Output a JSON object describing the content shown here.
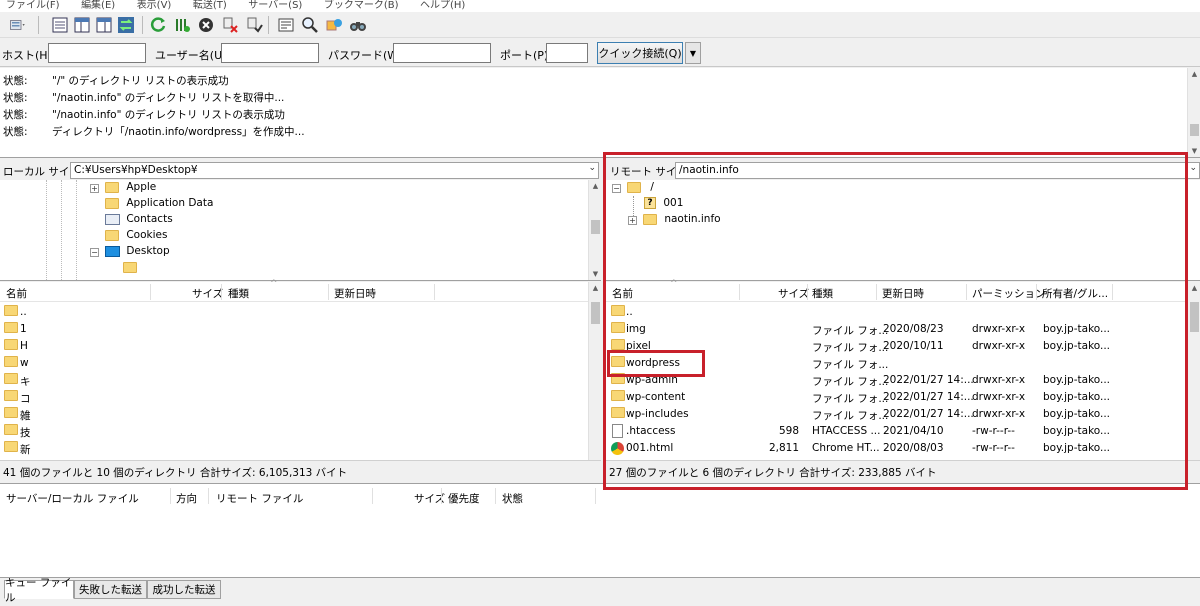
{
  "menu": [
    "ファイル(F)",
    "編集(E)",
    "表示(V)",
    "転送(T)",
    "サーバー(S)",
    "ブックマーク(B)",
    "ヘルプ(H)"
  ],
  "quickconnect": {
    "host_label": "ホスト(H):",
    "user_label": "ユーザー名(U):",
    "pass_label": "パスワード(W):",
    "port_label": "ポート(P):",
    "connect_label": "クイック接続(Q)",
    "dropdown": "▼"
  },
  "log": [
    {
      "status": "状態:",
      "message": "\"/\" のディレクトリ リストの表示成功"
    },
    {
      "status": "状態:",
      "message": "\"/naotin.info\" のディレクトリ リストを取得中..."
    },
    {
      "status": "状態:",
      "message": "\"/naotin.info\" のディレクトリ リストの表示成功"
    },
    {
      "status": "状態:",
      "message": "ディレクトリ「/naotin.info/wordpress」を作成中..."
    }
  ],
  "local": {
    "site_label": "ローカル サイト:",
    "path": "C:¥Users¥hp¥Desktop¥",
    "tree": [
      {
        "label": "Apple",
        "icon": "folder-icon",
        "expander": "+"
      },
      {
        "label": "Application Data",
        "icon": "folder-icon",
        "expander": ""
      },
      {
        "label": "Contacts",
        "icon": "contacts-icon",
        "expander": ""
      },
      {
        "label": "Cookies",
        "icon": "folder-icon",
        "expander": ""
      },
      {
        "label": "Desktop",
        "icon": "desktop-icon",
        "expander": "−"
      },
      {
        "label": "",
        "icon": "folder-icon",
        "expander": ""
      }
    ],
    "columns": [
      "名前",
      "サイズ",
      "種類",
      "更新日時"
    ],
    "files": [
      "..",
      "1",
      "H",
      "w",
      "キ",
      "コ",
      "雑",
      "技",
      "新"
    ],
    "status": "41 個のファイルと 10 個のディレクトリ 合計サイズ: 6,105,313 バイト"
  },
  "remote": {
    "site_label": "リモート サイト:",
    "path": "/naotin.info",
    "tree": [
      {
        "label": "/",
        "icon": "folder-icon",
        "expander": "−"
      },
      {
        "label": "001",
        "icon": "unknown-folder-icon",
        "expander": ""
      },
      {
        "label": "naotin.info",
        "icon": "folder-icon",
        "expander": "+"
      }
    ],
    "columns": [
      "名前",
      "サイズ",
      "種類",
      "更新日時",
      "パーミッション",
      "所有者/グル..."
    ],
    "files": [
      {
        "name": "..",
        "size": "",
        "type": "",
        "date": "",
        "perm": "",
        "owner": "",
        "icon": "folder-icon"
      },
      {
        "name": "img",
        "size": "",
        "type": "ファイル フォ...",
        "date": "2020/08/23",
        "perm": "drwxr-xr-x",
        "owner": "boy.jp-tako...",
        "icon": "folder-icon"
      },
      {
        "name": "pixel",
        "size": "",
        "type": "ファイル フォ...",
        "date": "2020/10/11",
        "perm": "drwxr-xr-x",
        "owner": "boy.jp-tako...",
        "icon": "folder-icon"
      },
      {
        "name": "wordpress",
        "size": "",
        "type": "ファイル フォ...",
        "date": "",
        "perm": "",
        "owner": "",
        "icon": "folder-icon"
      },
      {
        "name": "wp-admin",
        "size": "",
        "type": "ファイル フォ...",
        "date": "2022/01/27 14:...",
        "perm": "drwxr-xr-x",
        "owner": "boy.jp-tako...",
        "icon": "folder-icon"
      },
      {
        "name": "wp-content",
        "size": "",
        "type": "ファイル フォ...",
        "date": "2022/01/27 14:...",
        "perm": "drwxr-xr-x",
        "owner": "boy.jp-tako...",
        "icon": "folder-icon"
      },
      {
        "name": "wp-includes",
        "size": "",
        "type": "ファイル フォ...",
        "date": "2022/01/27 14:...",
        "perm": "drwxr-xr-x",
        "owner": "boy.jp-tako...",
        "icon": "folder-icon"
      },
      {
        "name": ".htaccess",
        "size": "598",
        "type": "HTACCESS ...",
        "date": "2021/04/10",
        "perm": "-rw-r--r--",
        "owner": "boy.jp-tako...",
        "icon": "file-icon"
      },
      {
        "name": "001.html",
        "size": "2,811",
        "type": "Chrome HT...",
        "date": "2020/08/03",
        "perm": "-rw-r--r--",
        "owner": "boy.jp-tako...",
        "icon": "chrome-icon"
      }
    ],
    "status": "27 個のファイルと 6 個のディレクトリ 合計サイズ: 233,885 バイト"
  },
  "queue": {
    "columns": [
      "サーバー/ローカル ファイル",
      "方向",
      "リモート ファイル",
      "サイズ",
      "優先度",
      "状態"
    ]
  },
  "tabs": [
    "キュー ファイル",
    "失敗した転送",
    "成功した転送"
  ],
  "colors": {
    "highlight": "#c8202a",
    "folder": "#f8d775"
  }
}
